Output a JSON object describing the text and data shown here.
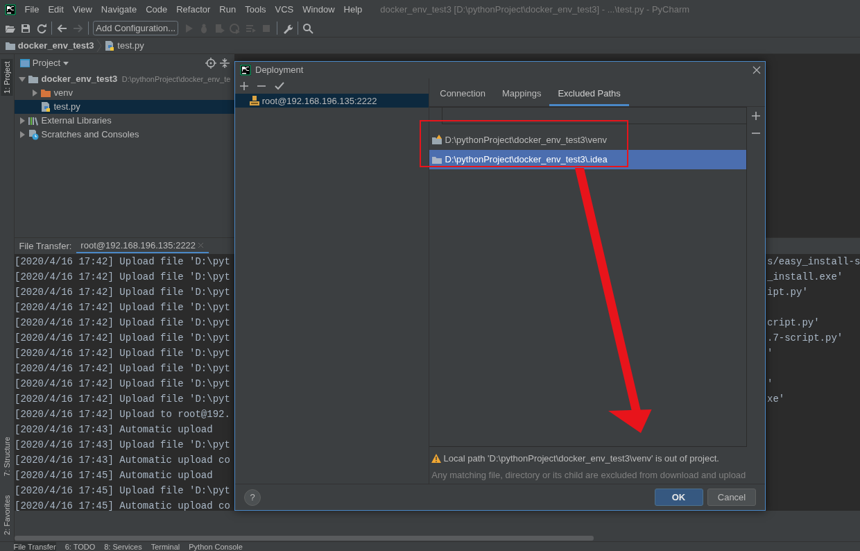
{
  "menu_bar": {
    "items": [
      "File",
      "Edit",
      "View",
      "Navigate",
      "Code",
      "Refactor",
      "Run",
      "Tools",
      "VCS",
      "Window",
      "Help"
    ],
    "title": "docker_env_test3 [D:\\pythonProject\\docker_env_test3] - ...\\test.py - PyCharm"
  },
  "toolbar": {
    "run_config": "Add Configuration..."
  },
  "breadcrumb": [
    "docker_env_test3",
    "test.py"
  ],
  "side_stripe": [
    {
      "label": "1: Project",
      "selected": true
    },
    {
      "label": "7: Structure",
      "selected": false
    },
    {
      "label": "2: Favorites",
      "selected": false
    }
  ],
  "project_panel": {
    "title": "Project",
    "tree": [
      {
        "label": "docker_env_test3",
        "path": "D:\\pythonProject\\docker_env_te",
        "kind": "project",
        "expanded": true,
        "selected": false,
        "children": [
          {
            "label": "venv",
            "kind": "venv",
            "expanded": false,
            "selected": false
          },
          {
            "label": "test.py",
            "kind": "python",
            "selected": true
          }
        ]
      },
      {
        "label": "External Libraries",
        "kind": "libraries",
        "expanded": false,
        "selected": false
      },
      {
        "label": "Scratches and Consoles",
        "kind": "scratches",
        "expanded": false,
        "selected": false
      }
    ]
  },
  "file_transfer": {
    "title": "File Transfer:",
    "tab": "root@192.168.196.135:2222",
    "lines": [
      {
        "text": "[2020/4/16 17:42] Upload file 'D:\\pyt",
        "tail": "s/easy_install-s"
      },
      {
        "text": "[2020/4/16 17:42] Upload file 'D:\\pyt",
        "tail": "_install.exe'"
      },
      {
        "text": "[2020/4/16 17:42] Upload file 'D:\\pyt",
        "tail": "ipt.py'"
      },
      {
        "text": "[2020/4/16 17:42] Upload file 'D:\\pyt"
      },
      {
        "text": "[2020/4/16 17:42] Upload file 'D:\\pyt",
        "tail": "cript.py'"
      },
      {
        "text": "[2020/4/16 17:42] Upload file 'D:\\pyt",
        "tail": ".7-script.py'"
      },
      {
        "text": "[2020/4/16 17:42] Upload file 'D:\\pyt",
        "tail": "'"
      },
      {
        "text": "[2020/4/16 17:42] Upload file 'D:\\pyt"
      },
      {
        "text": "[2020/4/16 17:42] Upload file 'D:\\pyt",
        "tail": "'"
      },
      {
        "text": "[2020/4/16 17:42] Upload file 'D:\\pyt",
        "tail": "xe'"
      },
      {
        "text": "[2020/4/16 17:42] Upload to root@192."
      },
      {
        "text": "[2020/4/16 17:43] Automatic upload"
      },
      {
        "text": "[2020/4/16 17:43] Upload file 'D:\\pyt"
      },
      {
        "text": "[2020/4/16 17:43] Automatic upload co"
      },
      {
        "text": "[2020/4/16 17:45] Automatic upload"
      },
      {
        "text": "[2020/4/16 17:45] Upload file 'D:\\pyt"
      },
      {
        "text": "[2020/4/16 17:45] Automatic upload co"
      }
    ]
  },
  "dialog": {
    "title": "Deployment",
    "servers": [
      {
        "label": "root@192.168.196.135:2222",
        "selected": true
      }
    ],
    "tabs": [
      {
        "label": "Connection",
        "selected": false
      },
      {
        "label": "Mappings",
        "selected": false
      },
      {
        "label": "Excluded Paths",
        "selected": true
      }
    ],
    "excluded_paths": [
      {
        "path": "D:\\pythonProject\\docker_env_test3\\venv",
        "warning": true,
        "selected": false
      },
      {
        "path": "D:\\pythonProject\\docker_env_test3\\.idea",
        "warning": false,
        "selected": true
      }
    ],
    "warning": "Local path 'D:\\pythonProject\\docker_env_test3\\venv' is out of project.",
    "hint": "Any matching file, directory or its child are excluded from download and upload",
    "help": "?",
    "buttons": [
      {
        "label": "OK",
        "kind": "primary"
      },
      {
        "label": "Cancel",
        "kind": "secondary"
      }
    ]
  },
  "bottom_tabs": [
    {
      "label": "File Transfer",
      "selected": true
    },
    {
      "label": "6: TODO",
      "selected": false
    },
    {
      "label": "8: Services",
      "selected": false
    },
    {
      "label": "Terminal",
      "selected": false
    },
    {
      "label": "Python Console",
      "selected": false
    }
  ]
}
